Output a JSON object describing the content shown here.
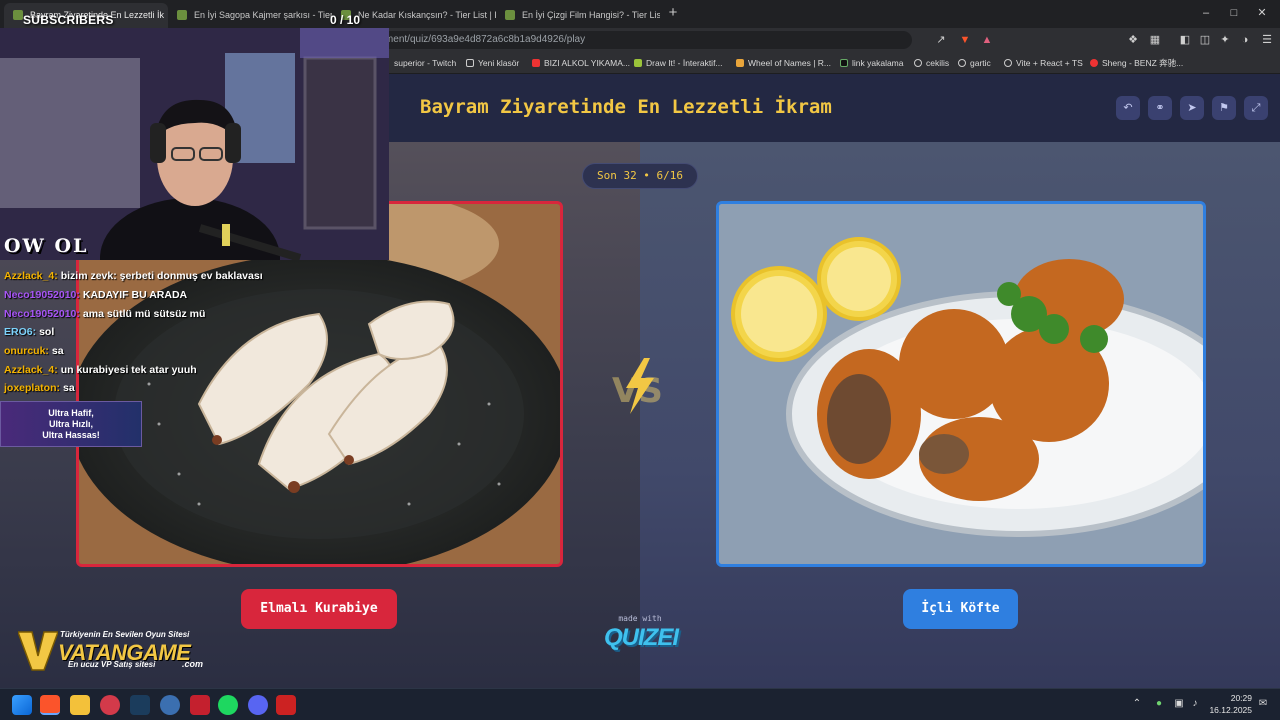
{
  "browser": {
    "tabs": [
      {
        "label": "Bayram Ziyaretinde En Lezzetli İk",
        "active": true
      },
      {
        "label": "En İyi Sagopa Kajmer şarkısı - Tier List",
        "active": false
      },
      {
        "label": "Ne Kadar Kıskançsın? - Tier List | Kör",
        "active": false
      },
      {
        "label": "En İyi Çizgi Film Hangisi? - Tier List | ",
        "active": false
      }
    ],
    "url": "quizei.com/tournament/quiz/693a9e4d872a6c8b1a9d4926/play",
    "bookmarks": [
      "superior - Twitch",
      "Yeni klasör",
      "BIZI ALKOL YIKAMA...",
      "Draw It! - İnteraktif...",
      "Wheel of Names | R...",
      "link yakalama",
      "cekilis",
      "gartic",
      "Vite + React + TS",
      "Sheng - BENZ 奔驰..."
    ]
  },
  "quiz": {
    "title": "Bayram Ziyaretinde En Lezzetli İkram",
    "round_badge": "Son 32 • 6/16",
    "left_choice": "Elmalı Kurabiye",
    "right_choice": "İçli Köfte",
    "vs_label": "VS",
    "made_with": "made with",
    "brand": "QUIZEI"
  },
  "stream": {
    "subscribers_label": "SUBSCRIBERS",
    "subscribers_count": "0 / 10",
    "owl_tag": "OW OL",
    "chat": [
      {
        "user": "Azzlack_4:",
        "msg": "bizim zevk: şerbeti donmuş ev baklavası",
        "color": "#f5b400"
      },
      {
        "user": "Neco19052010:",
        "msg": "KADAYIF BU ARADA",
        "color": "#a855f7"
      },
      {
        "user": "Neco19052010:",
        "msg": "ama sütlü mü sütsüz mü",
        "color": "#a855f7"
      },
      {
        "user": "ERO6:",
        "msg": "sol",
        "color": "#7dd3fc"
      },
      {
        "user": "onurcuk:",
        "msg": "sa",
        "color": "#f5b400"
      },
      {
        "user": "Azzlack_4:",
        "msg": "un kurabiyesi tek atar yuuh",
        "color": "#f5b400"
      },
      {
        "user": "joxeplaton:",
        "msg": "sa",
        "color": "#f5b400"
      }
    ],
    "promo_lines": [
      "Ultra Hafif,",
      "Ultra Hızlı,",
      "Ultra Hassas!"
    ],
    "sponsor_tagline": "Türkiyenin En Sevilen Oyun Sitesi",
    "sponsor_name": "VATANGAME",
    "sponsor_sub": "En ucuz VP Satış sitesi",
    "sponsor_domain": ".com"
  },
  "taskbar": {
    "time": "20:29",
    "date": "16.12.2025"
  },
  "colors": {
    "accent_gold": "#f2c744",
    "left_red": "#d8263c",
    "right_blue": "#2f7fe0"
  }
}
